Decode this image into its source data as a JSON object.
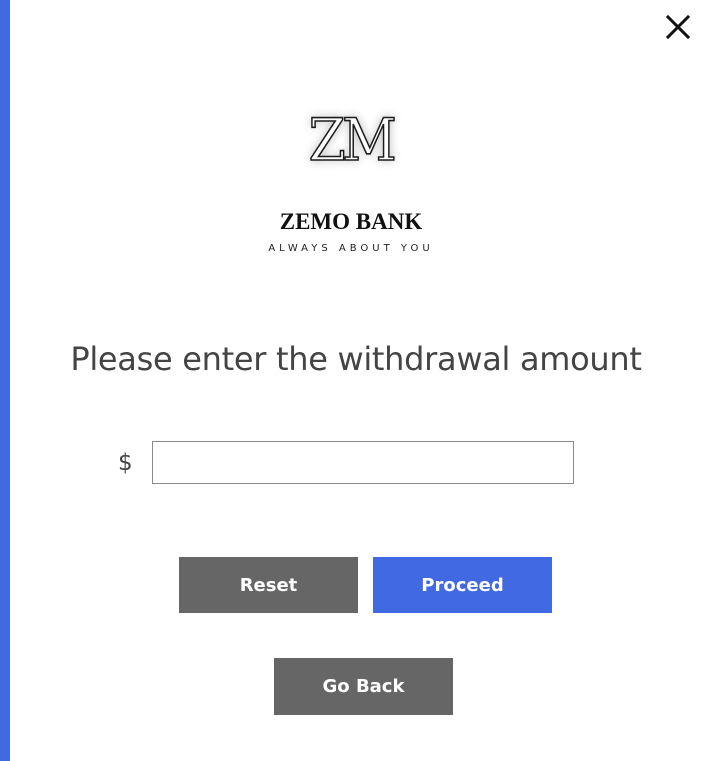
{
  "window": {
    "close_icon": "close-icon"
  },
  "brand": {
    "monogram": "ZM",
    "name": "ZEMO BANK",
    "tagline": "ALWAYS ABOUT YOU"
  },
  "form": {
    "prompt": "Please enter the withdrawal amount",
    "currency_symbol": "$",
    "amount_value": "",
    "amount_placeholder": ""
  },
  "buttons": {
    "reset_label": "Reset",
    "proceed_label": "Proceed",
    "back_label": "Go Back"
  },
  "colors": {
    "accent": "#4169e1",
    "secondary_button": "#666666",
    "text": "#444444"
  }
}
